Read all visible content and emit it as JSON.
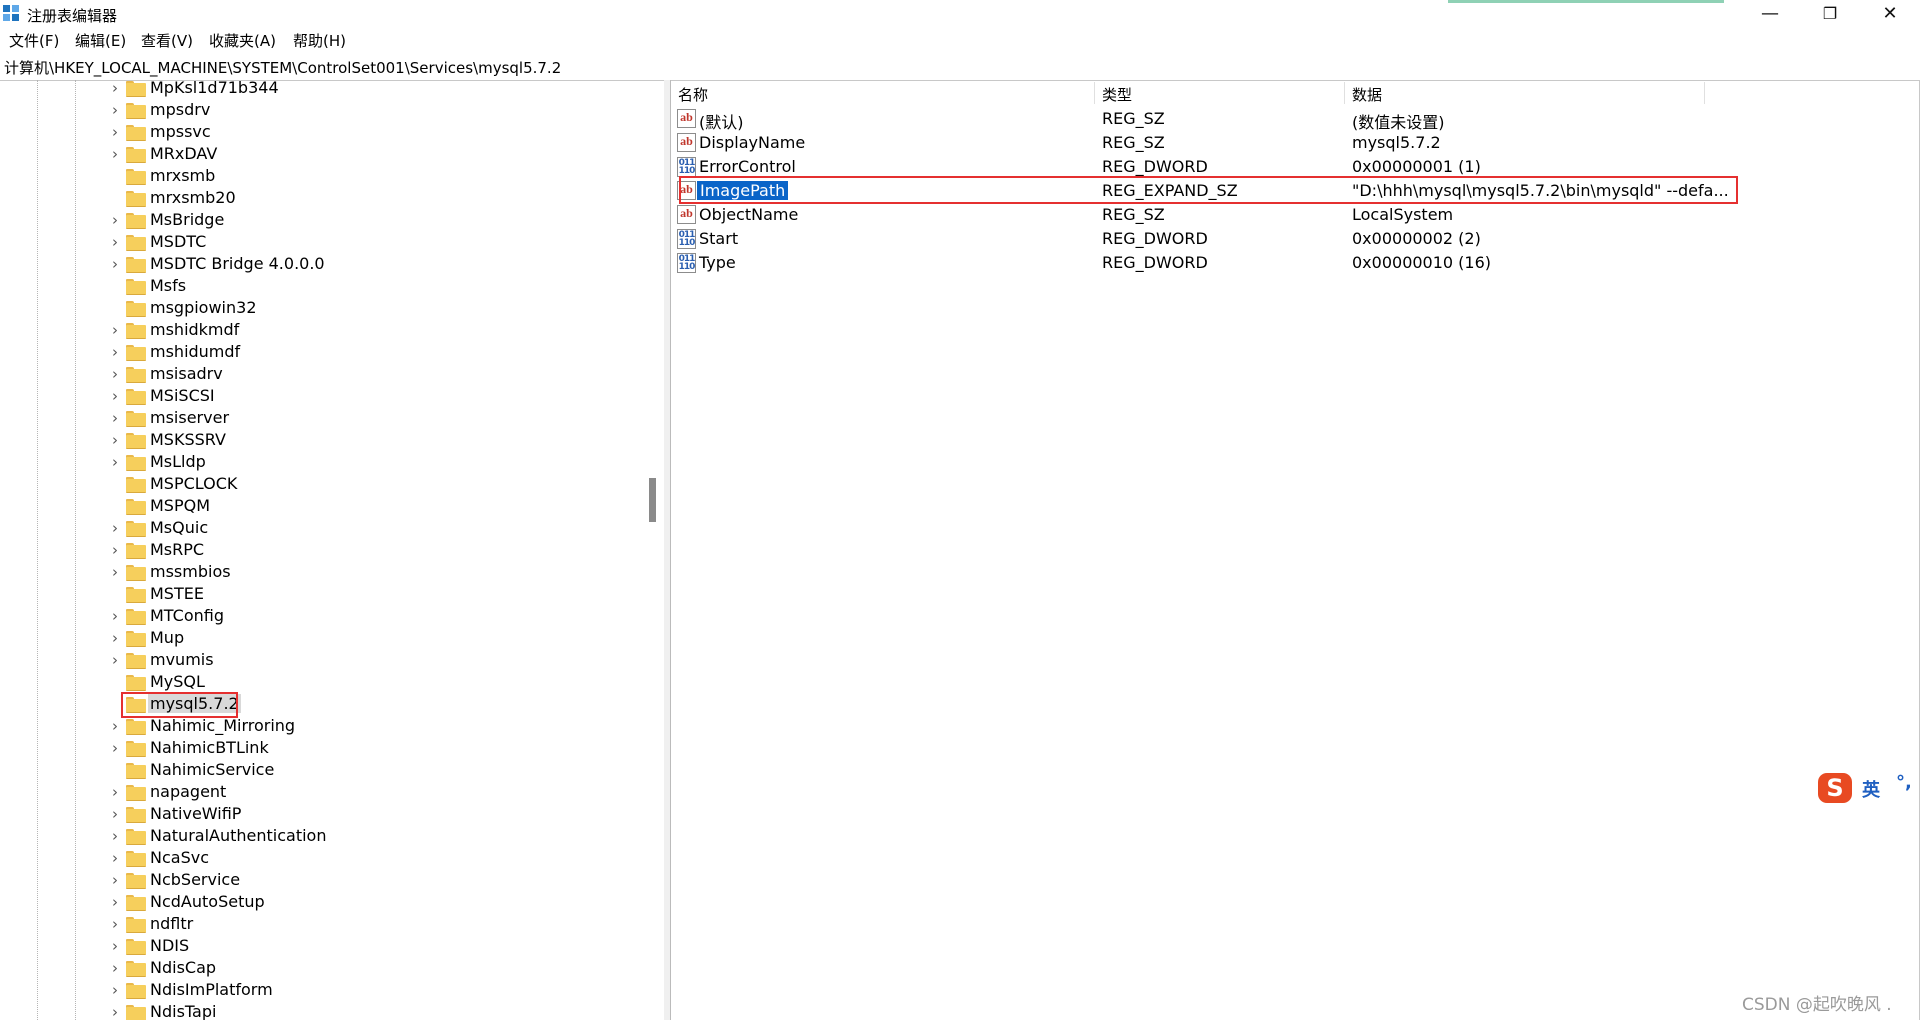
{
  "window": {
    "title": "注册表编辑器",
    "controls": {
      "minimize": "—",
      "restore": "❐",
      "close": "✕"
    }
  },
  "menu": [
    "文件(F)",
    "编辑(E)",
    "查看(V)",
    "收藏夹(A)",
    "帮助(H)"
  ],
  "address": "计算机\\HKEY_LOCAL_MACHINE\\SYSTEM\\ControlSet001\\Services\\mysql5.7.2",
  "tree": {
    "items": [
      {
        "label": "MpKsl1d71b344",
        "expandable": true
      },
      {
        "label": "mpsdrv",
        "expandable": true
      },
      {
        "label": "mpssvc",
        "expandable": true
      },
      {
        "label": "MRxDAV",
        "expandable": true
      },
      {
        "label": "mrxsmb",
        "expandable": false
      },
      {
        "label": "mrxsmb20",
        "expandable": false
      },
      {
        "label": "MsBridge",
        "expandable": true
      },
      {
        "label": "MSDTC",
        "expandable": true
      },
      {
        "label": "MSDTC Bridge 4.0.0.0",
        "expandable": true
      },
      {
        "label": "Msfs",
        "expandable": false
      },
      {
        "label": "msgpiowin32",
        "expandable": false
      },
      {
        "label": "mshidkmdf",
        "expandable": true
      },
      {
        "label": "mshidumdf",
        "expandable": true
      },
      {
        "label": "msisadrv",
        "expandable": true
      },
      {
        "label": "MSiSCSI",
        "expandable": true
      },
      {
        "label": "msiserver",
        "expandable": true
      },
      {
        "label": "MSKSSRV",
        "expandable": true
      },
      {
        "label": "MsLldp",
        "expandable": true
      },
      {
        "label": "MSPCLOCK",
        "expandable": false
      },
      {
        "label": "MSPQM",
        "expandable": false
      },
      {
        "label": "MsQuic",
        "expandable": true
      },
      {
        "label": "MsRPC",
        "expandable": true
      },
      {
        "label": "mssmbios",
        "expandable": true
      },
      {
        "label": "MSTEE",
        "expandable": false
      },
      {
        "label": "MTConfig",
        "expandable": true
      },
      {
        "label": "Mup",
        "expandable": true
      },
      {
        "label": "mvumis",
        "expandable": true
      },
      {
        "label": "MySQL",
        "expandable": false
      },
      {
        "label": "mysql5.7.2",
        "expandable": false,
        "selected": true
      },
      {
        "label": "Nahimic_Mirroring",
        "expandable": true
      },
      {
        "label": "NahimicBTLink",
        "expandable": true
      },
      {
        "label": "NahimicService",
        "expandable": false
      },
      {
        "label": "napagent",
        "expandable": true
      },
      {
        "label": "NativeWifiP",
        "expandable": true
      },
      {
        "label": "NaturalAuthentication",
        "expandable": true
      },
      {
        "label": "NcaSvc",
        "expandable": true
      },
      {
        "label": "NcbService",
        "expandable": true
      },
      {
        "label": "NcdAutoSetup",
        "expandable": true
      },
      {
        "label": "ndfltr",
        "expandable": true
      },
      {
        "label": "NDIS",
        "expandable": true
      },
      {
        "label": "NdisCap",
        "expandable": true
      },
      {
        "label": "NdisImPlatform",
        "expandable": true
      },
      {
        "label": "NdisTapi",
        "expandable": true
      }
    ]
  },
  "list": {
    "columns": {
      "name": "名称",
      "type": "类型",
      "data": "数据"
    },
    "rows": [
      {
        "icon": "ab",
        "name": "(默认)",
        "type": "REG_SZ",
        "data": "(数值未设置)"
      },
      {
        "icon": "ab",
        "name": "DisplayName",
        "type": "REG_SZ",
        "data": "mysql5.7.2"
      },
      {
        "icon": "bin",
        "name": "ErrorControl",
        "type": "REG_DWORD",
        "data": "0x00000001 (1)"
      },
      {
        "icon": "ab",
        "name": "ImagePath",
        "type": "REG_EXPAND_SZ",
        "data": "\"D:\\hhh\\mysql\\mysql5.7.2\\bin\\mysqld\" --defa...",
        "selected": true
      },
      {
        "icon": "ab",
        "name": "ObjectName",
        "type": "REG_SZ",
        "data": "LocalSystem"
      },
      {
        "icon": "bin",
        "name": "Start",
        "type": "REG_DWORD",
        "data": "0x00000002 (2)"
      },
      {
        "icon": "bin",
        "name": "Type",
        "type": "REG_DWORD",
        "data": "0x00000010 (16)"
      }
    ]
  },
  "ime": {
    "logo": "S",
    "lang": "英",
    "punct": "°,"
  },
  "watermark": "CSDN @起吹晚风 .",
  "colors": {
    "highlight_box": "#e53030",
    "selection": "#0a64c8",
    "folder": "#f6cf5c"
  }
}
